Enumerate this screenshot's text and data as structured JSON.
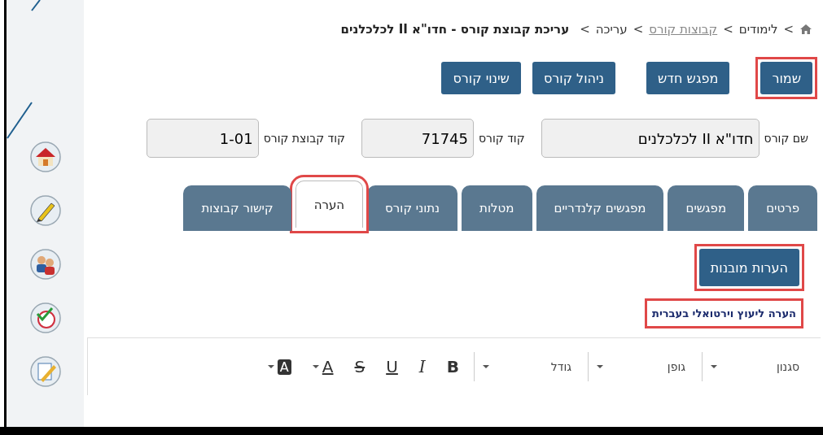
{
  "breadcrumb": [
    {
      "separator": ">",
      "label": "לימודים",
      "kind": "plain"
    },
    {
      "separator": ">",
      "label": "קבוצות קורס",
      "kind": "link"
    },
    {
      "separator": ">",
      "label": "עריכה",
      "kind": "plain"
    },
    {
      "separator": ">",
      "label": "עריכת קבוצת קורס - חדו\"א II לכלכלנים",
      "kind": "current"
    }
  ],
  "actions": [
    {
      "label": "שמור",
      "highlighted": true
    },
    {
      "label": "מפגש חדש",
      "highlighted": false
    },
    {
      "label": "ניהול קורס",
      "highlighted": false
    },
    {
      "label": "שינוי קורס",
      "highlighted": false
    }
  ],
  "fields": [
    {
      "label": "שם קורס",
      "value": "חדו\"א II לכלכלנים"
    },
    {
      "label": "קוד קורס",
      "value": "71745"
    },
    {
      "label": "קוד קבוצת קורס",
      "value": "1-01"
    }
  ],
  "tabs": [
    {
      "label": "פרטים",
      "selected": false,
      "highlighted": false
    },
    {
      "label": "מפגשים",
      "selected": false,
      "highlighted": false
    },
    {
      "label": "מפגשים קלנדריים",
      "selected": false,
      "highlighted": false
    },
    {
      "label": "מטלות",
      "selected": false,
      "highlighted": false
    },
    {
      "label": "נתוני קורס",
      "selected": false,
      "highlighted": false
    },
    {
      "label": "הערה",
      "selected": true,
      "highlighted": true
    },
    {
      "label": "קישור קבוצות",
      "selected": false,
      "highlighted": false
    }
  ],
  "note_button": {
    "label": "הערות מובנות",
    "highlighted": true
  },
  "note_label": {
    "text": "הערה ליעוץ וירטואלי בעברית",
    "highlighted": true
  },
  "editor_toolbar": [
    {
      "kind": "dropdown",
      "label": "סגנון"
    },
    {
      "kind": "dropdown",
      "label": "גופן"
    },
    {
      "kind": "dropdown",
      "label": "גודל"
    },
    {
      "kind": "bold",
      "label": "B"
    },
    {
      "kind": "italic",
      "label": "I"
    },
    {
      "kind": "underline",
      "label": "U"
    },
    {
      "kind": "strike",
      "label": "S"
    },
    {
      "kind": "textcolor",
      "label": "A"
    },
    {
      "kind": "bgcolor",
      "label": "A"
    }
  ]
}
